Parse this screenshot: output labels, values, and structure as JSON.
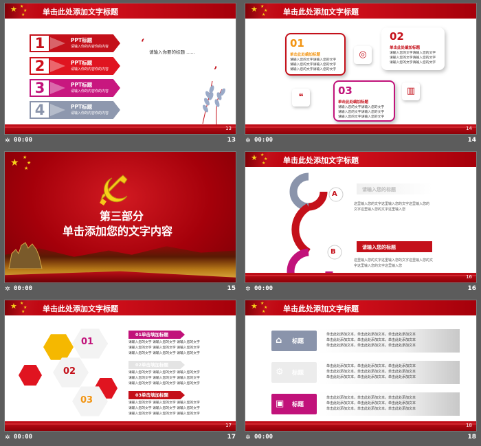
{
  "colors": {
    "red": "#c4101a",
    "pink": "#c1127a",
    "gold": "#f7d21a",
    "gray": "#8a94ab"
  },
  "slides": [
    {
      "title": "单击此处添加文字标题",
      "time": "00:00",
      "number": "13",
      "items": [
        {
          "n": "1",
          "title": "PPT标题",
          "desc": "请输入你的内容你的内容"
        },
        {
          "n": "2",
          "title": "PPT标题",
          "desc": "请输入你的内容你的内容"
        },
        {
          "n": "3",
          "title": "PPT标题",
          "desc": "请输入你的内容你的内容"
        },
        {
          "n": "4",
          "title": "PPT标题",
          "desc": "请输入你的内容你的内容"
        }
      ],
      "quote_text": "请输入你要的标题 ......",
      "page_label": "13"
    },
    {
      "title": "单击此处添加文字标题",
      "time": "00:00",
      "number": "14",
      "bubbles": [
        {
          "n": "01",
          "title": "单击此处编加标题",
          "desc": [
            "请输入您的文字请输入您的文字",
            "请输入您的文字请输入您的文字",
            "请输入您的文字请输入您的文字"
          ]
        },
        {
          "n": "02",
          "title": "单击此处编加标题",
          "desc": [
            "请输入您的文字请输入您的文字",
            "请输入您的文字请输入您的文字",
            "请输入您的文字请输入您的文字"
          ]
        },
        {
          "n": "03",
          "title": "单击此处编加标题",
          "desc": [
            "请输入您的文字请输入您的文字",
            "请输入您的文字请输入您的文字",
            "请输入您的文字请输入您的文字"
          ]
        }
      ],
      "page_label": "14"
    },
    {
      "title_line1": "第三部分",
      "title_line2": "单击添加您的文字内容",
      "time": "00:00",
      "number": "15",
      "page_label": "15"
    },
    {
      "title": "单击此处添加文字标题",
      "time": "00:00",
      "number": "16",
      "letter_a": "A",
      "letter_b": "B",
      "item_a_title": "请输入您的标题",
      "item_a_desc": [
        "这里输入您的文字这里输入您的文字这里输入您的",
        "文字这里输入您的文字这里输入您"
      ],
      "item_b_title": "请输入您的标题",
      "item_b_desc": [
        "这里输入您的文字这里输入您的文字这里输入您的文",
        "字这里输入您的文字这里输入您"
      ],
      "page_label": "16"
    },
    {
      "title": "单击此处添加文字标题",
      "time": "00:00",
      "number": "17",
      "hex_labels": [
        "01",
        "02",
        "03"
      ],
      "items": [
        {
          "title": "01单击填加标题",
          "desc": [
            "请输入您的文字  请输入您的文字  请输入您的文字",
            "请输入您的文字  请输入您的文字  请输入您的文字",
            "请输入您的文字  请输入您的文字  请输入您的文字"
          ]
        },
        {
          "title": "02单击填加标题",
          "desc": [
            "请输入您的文字  请输入您的文字  请输入您的文字",
            "请输入您的文字  请输入您的文字  请输入您的文字",
            "请输入您的文字  请输入您的文字  请输入您的文字"
          ]
        },
        {
          "title": "03单击填加标题",
          "desc": [
            "请输入您的文字  请输入您的文字  请输入您的文字",
            "请输入您的文字  请输入您的文字  请输入您的文字",
            "请输入您的文字  请输入您的文字  请输入您的文字"
          ]
        }
      ],
      "page_label": "17"
    },
    {
      "title": "单击此处添加文字标题",
      "time": "00:00",
      "number": "18",
      "rows": [
        {
          "label": "标题",
          "icon": "home-icon",
          "lines": [
            "单击此处添加文本，单击此处添加文本，单击此处添加文本",
            "单击此处添加文本，单击此处添加文本，单击此处添加文本",
            "单击此处添加文本，单击此处添加文本，单击此处添加文本"
          ]
        },
        {
          "label": "标题",
          "icon": "gears-icon",
          "lines": [
            "单击此处添加文本，单击此处添加文本，单击此处添加文本",
            "单击此处添加文本，单击此处添加文本，单击此处添加文本",
            "单击此处添加文本，单击此处添加文本，单击此处添加文本"
          ]
        },
        {
          "label": "标题",
          "icon": "suitcase-icon",
          "lines": [
            "单击此处添加文本，单击此处添加文本，单击此处添加文本",
            "单击此处添加文本，单击此处添加文本，单击此处添加文本",
            "单击此处添加文本，单击此处添加文本，单击此处添加文本"
          ]
        }
      ],
      "page_label": "18"
    }
  ]
}
